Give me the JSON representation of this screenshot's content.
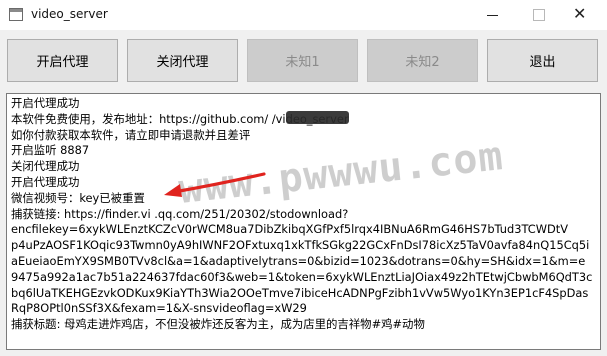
{
  "window": {
    "title": "video_server",
    "close_glyph": "✕"
  },
  "toolbar": {
    "buttons": [
      {
        "label": "开启代理",
        "enabled": true
      },
      {
        "label": "关闭代理",
        "enabled": true
      },
      {
        "label": "未知1",
        "enabled": false
      },
      {
        "label": "未知2",
        "enabled": false
      },
      {
        "label": "退出",
        "enabled": true
      }
    ]
  },
  "log": {
    "lines": [
      "开启代理成功",
      "本软件免费使用，发布地址：https://github.com/              /video_server",
      "如你付款获取本软件，请立即申请退款并且差评",
      "开启监听 8887",
      "关闭代理成功",
      "开启代理成功",
      "微信视频号：key已被重置",
      "捕获链接: https://finder.vi  .qq.com/251/20302/stodownload?",
      "encfilekey=6xykWLEnztKCZcV0rWCM8ua7DibZkibqXGfPxf5lrqx4IBNuA6RmG46HS7bTud3TCWDtV",
      "p4uPzAOSF1KOqic93Twmn0yA9hIWNF2OFxtuxq1xkTfkSGkg22GCxFnDsI78icXz5TaV0avfa84nQ15Cq5i",
      "aEueiaoEmYX9SMB0TVv8cl&a=1&adaptivelytrans=0&bizid=1023&dotrans=0&hy=SH&idx=1&m=e",
      "9475a992a1ac7b51a224637fdac60f3&web=1&token=6xykWLEnztLiaJOiax49z2hTEtwjCbwbM6QdT3c",
      "bq6lUaTKEHGEzvkODKux9KiaYTh3Wia2OOeTmve7ibiceHcADNPgFzibh1vVw5Wyo1KYn3EP1cF4SpDas",
      "RqP8OPtl0nSSf3X&fexam=1&X-snsvideoflag=xW29",
      "捕获标题: 母鸡走进炸鸡店，不但没被炸还反客为主，成为店里的吉祥物#鸡#动物"
    ]
  },
  "overlay": {
    "watermark": "www.pwwwu.com"
  },
  "colors": {
    "arrow": "#e0231e"
  }
}
